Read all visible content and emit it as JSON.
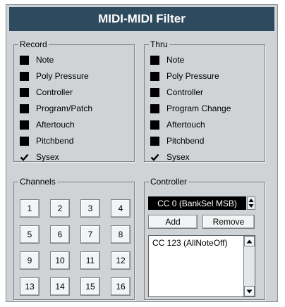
{
  "title": "MIDI-MIDI Filter",
  "record": {
    "label": "Record",
    "options": [
      {
        "label": "Note",
        "checked": false
      },
      {
        "label": "Poly Pressure",
        "checked": false
      },
      {
        "label": "Controller",
        "checked": false
      },
      {
        "label": "Program/Patch",
        "checked": false
      },
      {
        "label": "Aftertouch",
        "checked": false
      },
      {
        "label": "Pitchbend",
        "checked": false
      },
      {
        "label": "Sysex",
        "checked": true
      }
    ]
  },
  "thru": {
    "label": "Thru",
    "options": [
      {
        "label": "Note",
        "checked": false
      },
      {
        "label": "Poly Pressure",
        "checked": false
      },
      {
        "label": "Controller",
        "checked": false
      },
      {
        "label": "Program Change",
        "checked": false
      },
      {
        "label": "Aftertouch",
        "checked": false
      },
      {
        "label": "Pitchbend",
        "checked": false
      },
      {
        "label": "Sysex",
        "checked": true
      }
    ]
  },
  "channels": {
    "label": "Channels",
    "buttons": [
      "1",
      "2",
      "3",
      "4",
      "5",
      "6",
      "7",
      "8",
      "9",
      "10",
      "11",
      "12",
      "13",
      "14",
      "15",
      "16"
    ]
  },
  "controller": {
    "label": "Controller",
    "selected": "CC 0  (BankSel MSB)",
    "add_label": "Add",
    "remove_label": "Remove",
    "list_items": [
      "CC 123  (AllNoteOff)"
    ]
  }
}
